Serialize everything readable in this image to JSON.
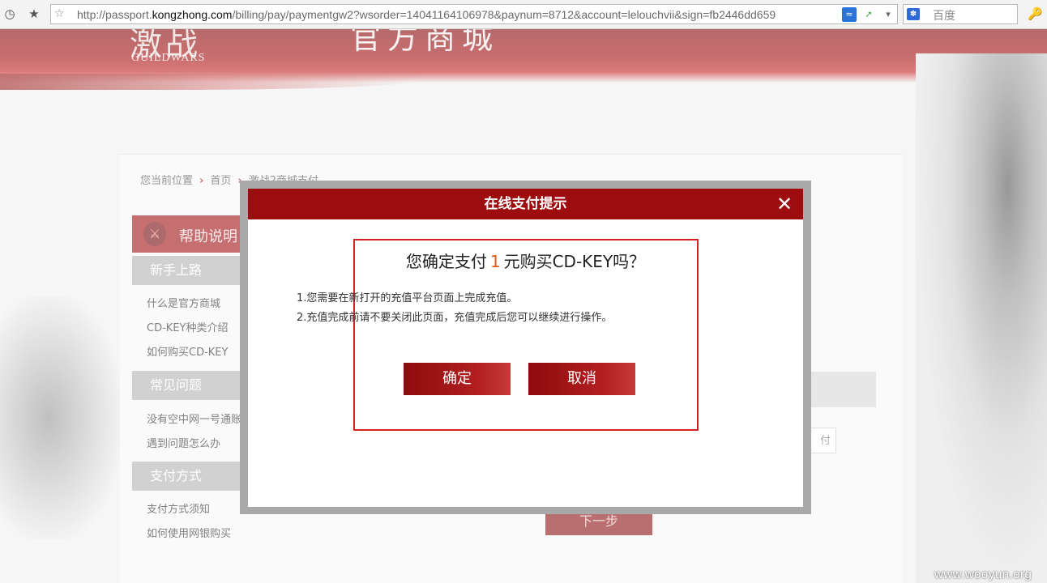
{
  "browser": {
    "url_prefix": "http://passport.",
    "url_domain": "kongzhong.com",
    "url_suffix": "/billing/pay/paymentgw2?wsorder=14041164106978&paynum=8712&account=lelouchvii&sign=fb2446dd659",
    "search_placeholder": "百度",
    "search_engine_icon": "baidu-paw-icon"
  },
  "banner": {
    "logo_cn": "激战",
    "logo_en": "GUILDWARS",
    "title": "官方商城"
  },
  "breadcrumb": {
    "label": "您当前位置",
    "home": "首页",
    "current": "激战2商城支付"
  },
  "sidebar": {
    "header": "帮助说明",
    "sections": [
      {
        "title": "新手上路",
        "links": [
          "什么是官方商城",
          "CD-KEY种类介绍",
          "如何购买CD-KEY"
        ]
      },
      {
        "title": "常见问题",
        "links": [
          "没有空中网一号通账",
          "遇到问题怎么办"
        ]
      },
      {
        "title": "支付方式",
        "links": [
          "支付方式须知",
          "如何使用网银购买"
        ]
      }
    ]
  },
  "main": {
    "pay_option_label": "付",
    "next_button": "下一步"
  },
  "modal": {
    "title": "在线支付提示",
    "close_symbol": "✕",
    "question_prefix": "您确定支付",
    "amount": "1",
    "question_suffix": "元购买CD-KEY吗？",
    "notes": [
      "1.您需要在新打开的充值平台页面上完成充值。",
      "2.充值完成前请不要关闭此页面，充值完成后您可以继续进行操作。"
    ],
    "confirm_label": "确定",
    "cancel_label": "取消"
  },
  "watermark": "www.wooyun.org",
  "colors": {
    "modal_header": "#9d0d0f",
    "button_red": "#8e0b0d",
    "highlight_border": "#d42222",
    "amount": "#e05a14"
  }
}
